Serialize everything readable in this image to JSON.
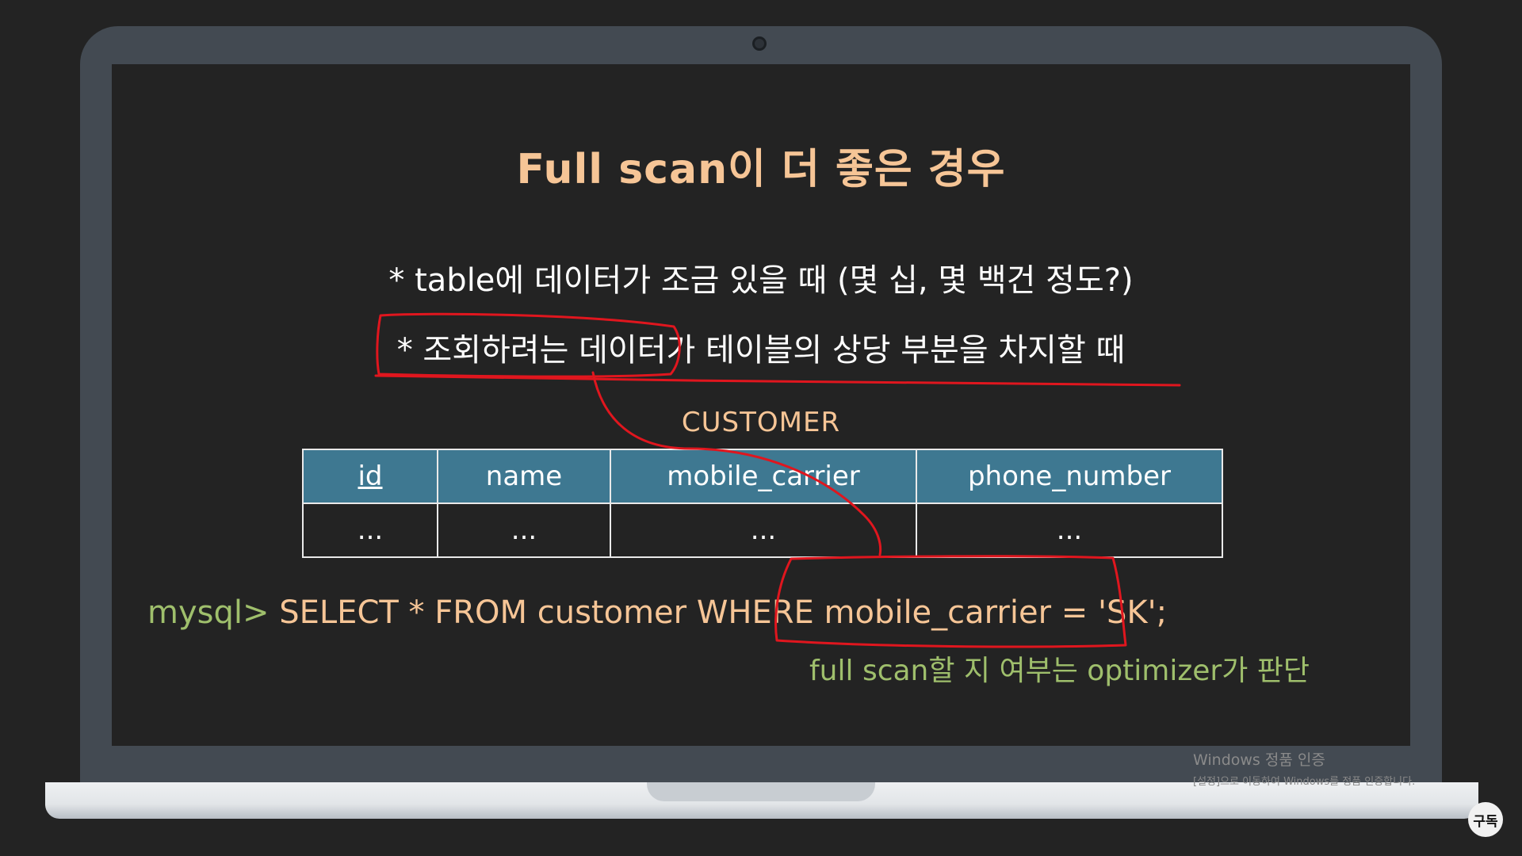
{
  "slide": {
    "title": "Full scan이 더 좋은 경우",
    "bullets": [
      "* table에 데이터가 조금 있을 때 (몇 십, 몇 백건 정도?)",
      "* 조회하려는 데이터가 테이블의 상당 부분을 차지할 때"
    ],
    "table": {
      "caption": "CUSTOMER",
      "columns": [
        "id",
        "name",
        "mobile_carrier",
        "phone_number"
      ],
      "rows": [
        [
          "...",
          "...",
          "...",
          "..."
        ]
      ]
    },
    "sql": {
      "prompt": "mysql>",
      "query": "SELECT * FROM customer WHERE mobile_carrier = 'SK';"
    },
    "note": "full scan할 지 여부는 optimizer가 판단"
  },
  "annotation_color": "#e0161e",
  "watermark": {
    "title": "Windows 정품 인증",
    "subtitle": "[설정]으로 이동하여 Windows를 정품 인증합니다."
  },
  "subscribe_badge": "구독"
}
